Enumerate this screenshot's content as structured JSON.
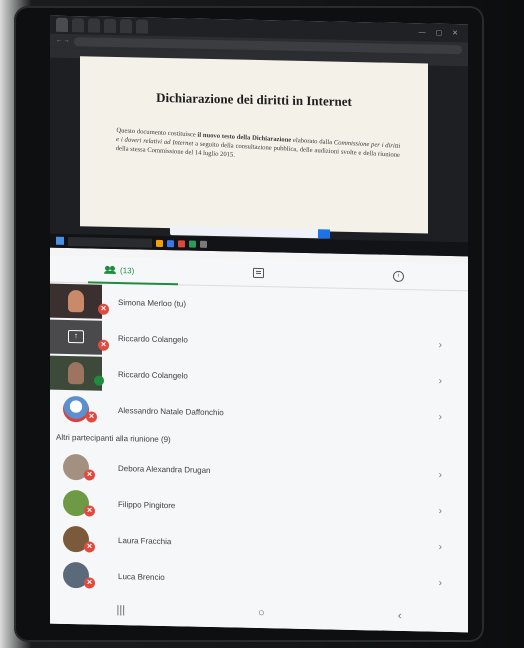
{
  "browser": {
    "tabs": [
      "",
      "",
      "",
      "",
      "",
      ""
    ],
    "document": {
      "title": "Dichiarazione dei diritti in Internet",
      "paragraph_parts": [
        "Questo documento costituisce ",
        "il nuovo testo della Dichiarazione",
        " elaborato dalla ",
        "Commissione per i diritti e i doveri relativi ad Internet",
        " a seguito della consultazione pubblica, delle audizioni svolte e della riunione della stessa Commissione del 14 luglio 2015."
      ]
    }
  },
  "panel": {
    "tabs": {
      "people_count": "(13)"
    },
    "participants": [
      {
        "name": "Simona Merloo (tu)",
        "thumb": "video",
        "face_color": "#c98a6a",
        "bg": "#3a3030",
        "status": "muted",
        "chevron": false
      },
      {
        "name": "Riccardo Colangelo",
        "thumb": "share",
        "status": "muted",
        "chevron": true
      },
      {
        "name": "Riccardo Colangelo",
        "thumb": "video",
        "face_color": "#9c7460",
        "bg": "#3d4a3a",
        "status": "talking",
        "chevron": true
      },
      {
        "name": "Alessandro Natale Daffonchio",
        "thumb": "avatar",
        "avatar_color": "#5b8fd0",
        "status": "muted",
        "chevron": true
      }
    ],
    "others_heading": "Altri partecipanti alla riunione (9)",
    "others": [
      {
        "name": "Debora Alexandra Drugan",
        "avatar_color": "#a39080",
        "chevron": true
      },
      {
        "name": "Filippo Pingitore",
        "avatar_color": "#6f9a45",
        "chevron": true
      },
      {
        "name": "Laura Fracchia",
        "avatar_color": "#7a5a3a",
        "chevron": true
      },
      {
        "name": "Luca Brencio",
        "avatar_color": "#5a6a7a",
        "chevron": true
      }
    ],
    "nav": [
      "|||",
      "○",
      "‹"
    ]
  },
  "colors": {
    "accent": "#1e8e3e",
    "mute": "#e04a3f"
  }
}
